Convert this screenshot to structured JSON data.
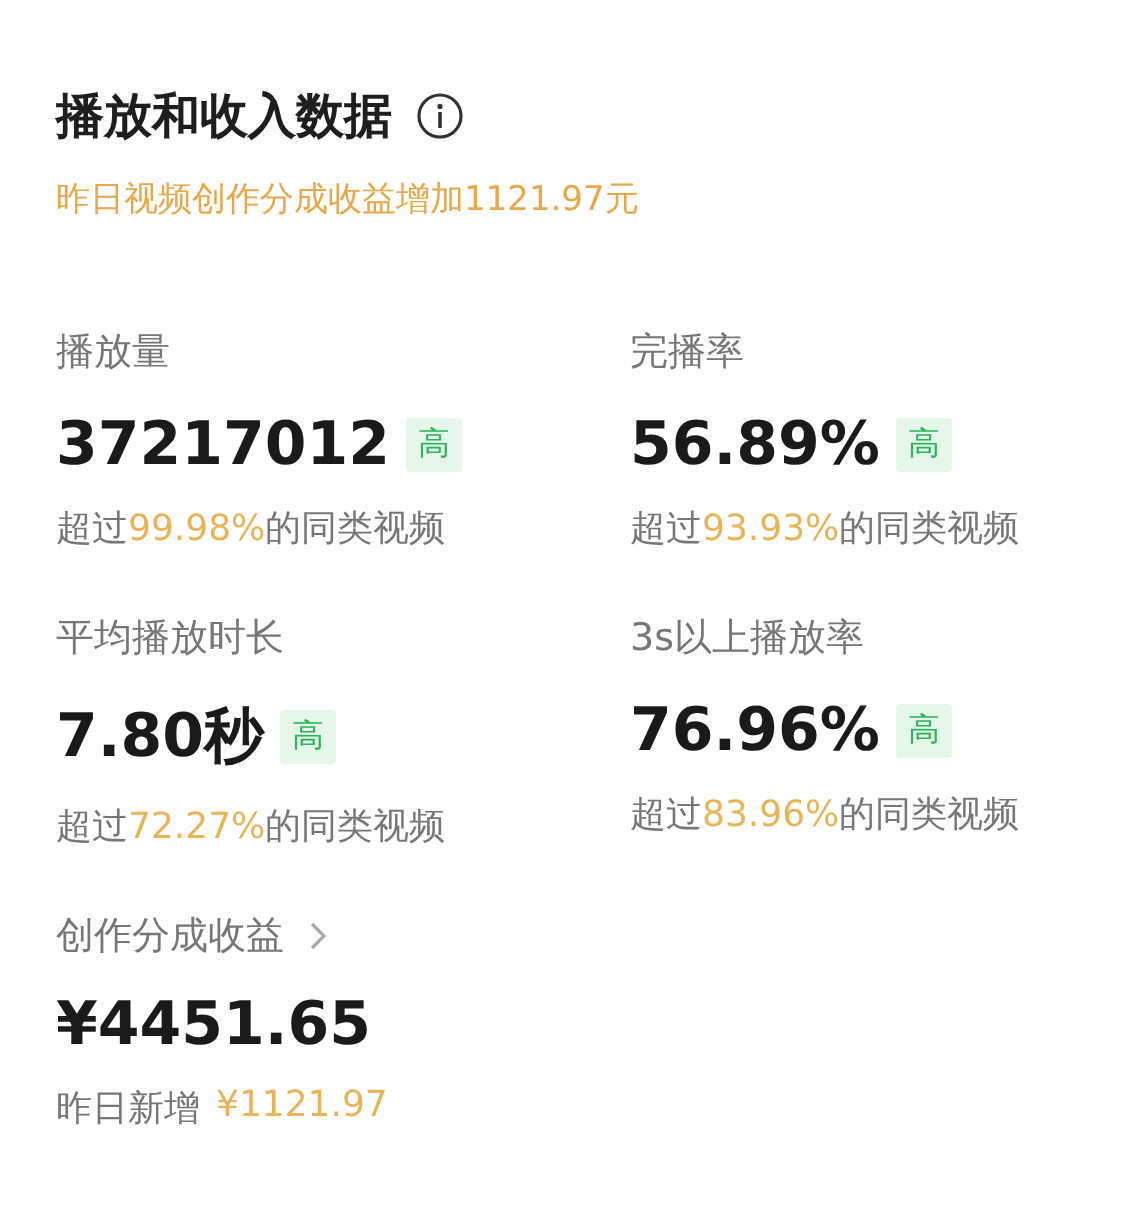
{
  "header": {
    "title": "播放和收入数据",
    "subtitle": "昨日视频创作分成收益增加1121.97元"
  },
  "metrics": [
    {
      "label": "播放量",
      "value": "37217012",
      "badge": "高",
      "compare": {
        "before": "超过",
        "highlight": "99.98%",
        "after": "的同类视频"
      }
    },
    {
      "label": "完播率",
      "value": "56.89%",
      "badge": "高",
      "compare": {
        "before": "超过",
        "highlight": "93.93%",
        "after": "的同类视频"
      }
    },
    {
      "label": "平均播放时长",
      "value": "7.80秒",
      "badge": "高",
      "compare": {
        "before": "超过",
        "highlight": "72.27%",
        "after": "的同类视频"
      }
    },
    {
      "label": "3s以上播放率",
      "value": "76.96%",
      "badge": "高",
      "compare": {
        "before": "超过",
        "highlight": "83.96%",
        "after": "的同类视频"
      }
    }
  ],
  "earnings": {
    "label": "创作分成收益",
    "value": "¥4451.65",
    "yesterday_label": "昨日新增",
    "yesterday_value": "¥1121.97"
  }
}
